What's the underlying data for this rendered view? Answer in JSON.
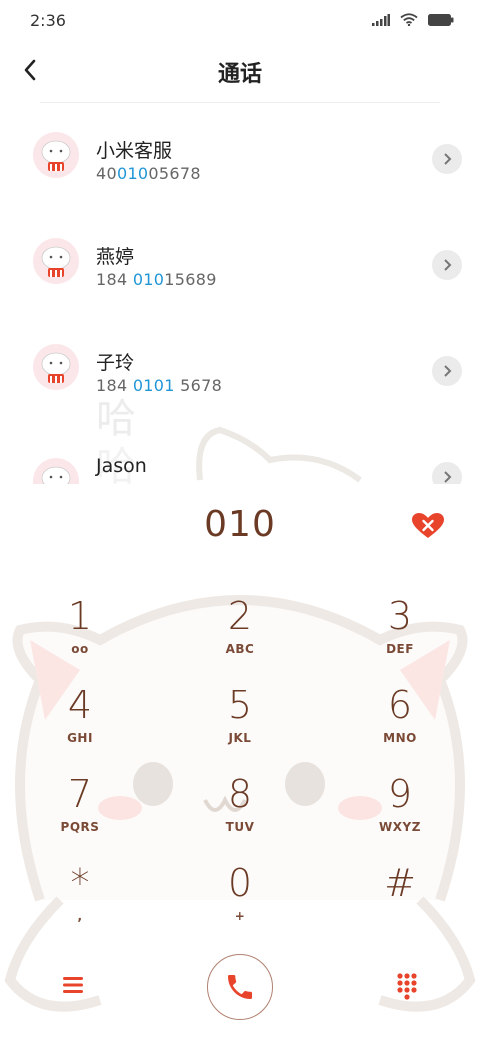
{
  "status_bar": {
    "time": "2:36"
  },
  "header": {
    "title": "通话"
  },
  "contacts": [
    {
      "name": "小米客服",
      "num_pre": "40",
      "num_hl": "010",
      "num_post": "05678"
    },
    {
      "name": "燕婷",
      "num_pre": "184 ",
      "num_hl": "010",
      "num_post": "15689"
    },
    {
      "name": "子玲",
      "num_pre": "184 ",
      "num_hl": "0101",
      "num_post": " 5678"
    },
    {
      "name": "Jason",
      "num_pre": "",
      "num_hl": "",
      "num_post": ""
    }
  ],
  "dialer": {
    "input": "010",
    "keys": [
      {
        "digit": "1",
        "letters": "oo"
      },
      {
        "digit": "2",
        "letters": "ABC"
      },
      {
        "digit": "3",
        "letters": "DEF"
      },
      {
        "digit": "4",
        "letters": "GHI"
      },
      {
        "digit": "5",
        "letters": "JKL"
      },
      {
        "digit": "6",
        "letters": "MNO"
      },
      {
        "digit": "7",
        "letters": "PQRS"
      },
      {
        "digit": "8",
        "letters": "TUV"
      },
      {
        "digit": "9",
        "letters": "WXYZ"
      },
      {
        "digit": "*",
        "letters": ","
      },
      {
        "digit": "0",
        "letters": "+"
      },
      {
        "digit": "#",
        "letters": ""
      }
    ]
  },
  "colors": {
    "accent_red": "#e8442c",
    "digit_brown": "#6b3a25",
    "highlight_blue": "#2196d6"
  },
  "icons": [
    "back-arrow-icon",
    "chevron-right-icon",
    "delete-heart-icon",
    "menu-icon",
    "phone-icon",
    "dialpad-icon",
    "signal-icon",
    "wifi-icon",
    "battery-icon"
  ]
}
